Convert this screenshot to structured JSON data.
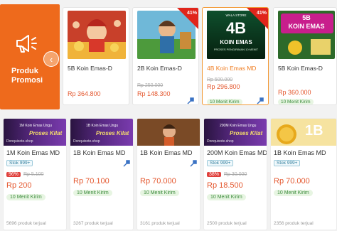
{
  "promo": {
    "title": "Produk Promosi",
    "prev_icon": "chevron-left-icon",
    "megaphone_icon": "megaphone-icon"
  },
  "promo_cards": [
    {
      "name": "5B Koin Emas-D",
      "price": "Rp 364.800",
      "old_price": "",
      "chip": "",
      "discount": ""
    },
    {
      "name": "2B Koin Emas-D",
      "price": "Rp 148.300",
      "old_price": "Rp 250.000",
      "chip": "",
      "discount": "41%"
    },
    {
      "name": "4B Koin Emas MD",
      "price": "Rp 296.800",
      "old_price": "Rp 500.000",
      "chip": "10 Menit Kirim",
      "discount": "41%",
      "thumb_big": "4B",
      "thumb_line": "KOIN EMAS",
      "thumb_top": "WALA STORE",
      "thumb_sub": "PROSES PENGIRIMAN 10 MENIT"
    },
    {
      "name": "5B Koin Emas-D",
      "price": "Rp 360.000",
      "old_price": "",
      "chip": "10 Menit Kirim",
      "discount": "",
      "thumb_big": "5B",
      "thumb_line": "KOIN EMAS"
    }
  ],
  "products": [
    {
      "title": "1M Koin Emas MD",
      "stock": "Stok 999+",
      "pct": "96%",
      "strike": "Rp 5.100",
      "price": "Rp 200",
      "chip": "10 Menit Kirim",
      "sold": "5696 produk terjual",
      "banner1": "1M Koin Emas Ungu",
      "banner2": "Proses Kilat",
      "banner3": "Donquixote.shop"
    },
    {
      "title": "1B Koin Emas MD",
      "stock": "",
      "pct": "",
      "strike": "",
      "price": "Rp 70.100",
      "chip": "10 Menit Kirim",
      "sold": "3267 produk terjual",
      "banner1": "1B Koin Emas Ungu",
      "banner2": "Proses Kilat",
      "banner3": "Donquixote.shop"
    },
    {
      "title": "1B Koin Emas MD",
      "stock": "",
      "pct": "",
      "strike": "",
      "price": "Rp 70.000",
      "chip": "10 Menit Kirim",
      "sold": "3161 produk terjual"
    },
    {
      "title": "200M Koin Emas MD",
      "stock": "Stok 999+",
      "pct": "38%",
      "strike": "Rp 30.000",
      "price": "Rp 18.500",
      "chip": "10 Menit Kirim",
      "sold": "2500 produk terjual",
      "banner1": "200M Koin Emas Ungu",
      "banner2": "Proses Kilat",
      "banner3": "Donquixote.shop"
    },
    {
      "title": "1B Koin Emas MD",
      "stock": "Stok 999+",
      "pct": "",
      "strike": "",
      "price": "Rp 70.000",
      "chip": "10 Menit Kirim",
      "sold": "2356 produk terjual",
      "banner_big": "1B"
    }
  ],
  "colors": {
    "accent": "#ee6a1c",
    "price": "#e4572e",
    "discount": "#e0413d",
    "chip_bg": "#e7f5e2",
    "chip_text": "#3a8a3a"
  }
}
